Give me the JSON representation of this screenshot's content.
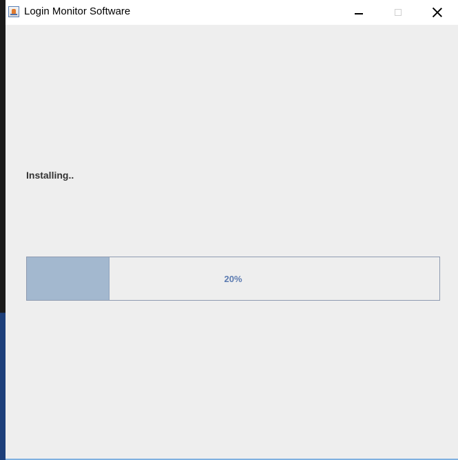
{
  "window": {
    "title": "Login Monitor Software",
    "icon": "java-app-icon",
    "controls": {
      "minimize": "minimize-icon",
      "maximize": "maximize-icon",
      "close": "close-icon"
    }
  },
  "main": {
    "status_label": "Installing..",
    "progress": {
      "value": 0.2,
      "text": "20%",
      "fill_color": "#a3b8cf",
      "text_color": "#5c7bb1"
    }
  }
}
